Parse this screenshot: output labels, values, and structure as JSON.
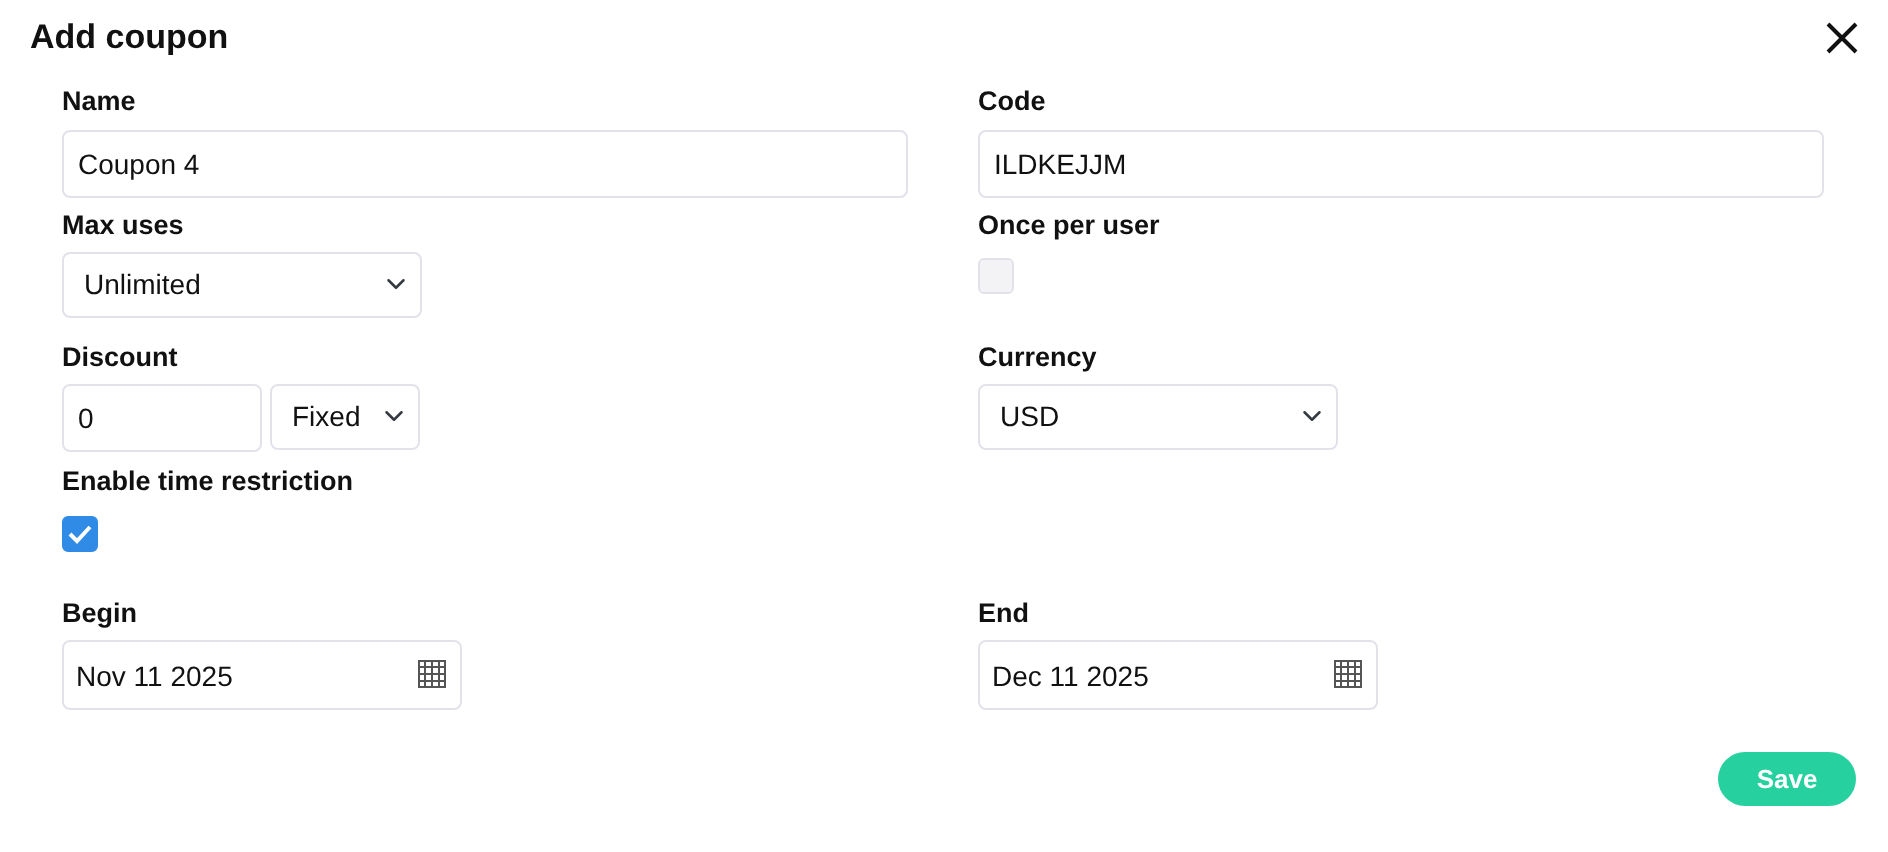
{
  "title": "Add coupon",
  "rows": [
    {
      "fields": [
        {
          "kind": "text",
          "label": "Name",
          "value": "Coupon 4"
        },
        {
          "kind": "text",
          "label": "Code",
          "value": "ILDKEJJM"
        }
      ]
    },
    {
      "fields": [
        {
          "kind": "select",
          "label": "Max uses",
          "value": "Unlimited"
        },
        {
          "kind": "checkbox",
          "label": "Once per user",
          "checked": false
        }
      ]
    },
    {
      "fields": [
        {
          "kind": "amount",
          "label": "Discount",
          "value": "0",
          "unit": "Fixed"
        },
        {
          "kind": "select",
          "label": "Currency",
          "value": "USD"
        }
      ]
    },
    {
      "fields": [
        {
          "kind": "checkbox",
          "label": "Enable time restriction",
          "checked": true
        }
      ]
    },
    {
      "fields": [
        {
          "kind": "date",
          "label": "Begin",
          "value": "Nov 11 2025"
        },
        {
          "kind": "date",
          "label": "End",
          "value": "Dec 11 2025"
        }
      ]
    }
  ],
  "buttons": [
    "Save"
  ]
}
